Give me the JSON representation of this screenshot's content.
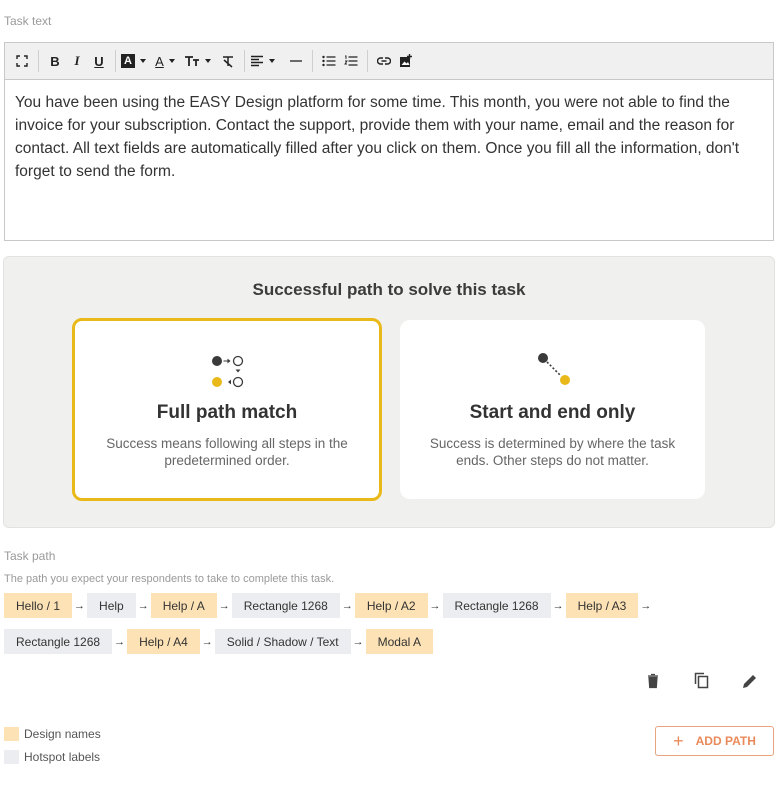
{
  "task_text": {
    "label": "Task text",
    "content": "You have been using the EASY Design platform for some time. This month, you were not able to find the invoice for your subscription. Contact the support, provide them with your name, email and the reason for contact. All text fields are automatically filled after you click on them. Once you fill all the information, don't forget to send the form.",
    "toolbar": {
      "bold": "B",
      "italic": "I",
      "underline": "U",
      "bg_color": "A",
      "font_color": "A",
      "font_size": "TT"
    }
  },
  "success_path": {
    "title": "Successful path to solve this task",
    "options": [
      {
        "title": "Full path match",
        "description": "Success means following all steps in the predetermined order.",
        "selected": true
      },
      {
        "title": "Start and end only",
        "description": "Success is determined by where the task ends. Other steps do not matter.",
        "selected": false
      }
    ]
  },
  "task_path": {
    "label": "Task path",
    "hint": "The path you expect your respondents to take to complete this task.",
    "row1": [
      {
        "text": "Hello / 1",
        "kind": "design"
      },
      {
        "text": "Help",
        "kind": "hotspot"
      },
      {
        "text": "Help / A",
        "kind": "design"
      },
      {
        "text": "Rectangle 1268",
        "kind": "hotspot"
      },
      {
        "text": "Help / A2",
        "kind": "design"
      },
      {
        "text": "Rectangle 1268",
        "kind": "hotspot"
      },
      {
        "text": "Help / A3",
        "kind": "design"
      }
    ],
    "row2": [
      {
        "text": "Rectangle 1268",
        "kind": "hotspot"
      },
      {
        "text": "Help / A4",
        "kind": "design"
      },
      {
        "text": "Solid / Shadow / Text",
        "kind": "hotspot"
      },
      {
        "text": "Modal A",
        "kind": "design"
      }
    ],
    "actions": [
      "trash-icon",
      "copy-icon",
      "pencil-icon"
    ]
  },
  "legend": {
    "design": "Design names",
    "hotspot": "Hotspot labels"
  },
  "add_path": {
    "label": "ADD PATH",
    "icon": "plus-icon"
  },
  "colors": {
    "accent_yellow": "#e9b91a",
    "design_chip": "#fde2b5",
    "hotspot_chip": "#ebedf0",
    "add_button": "#e98a5a"
  }
}
